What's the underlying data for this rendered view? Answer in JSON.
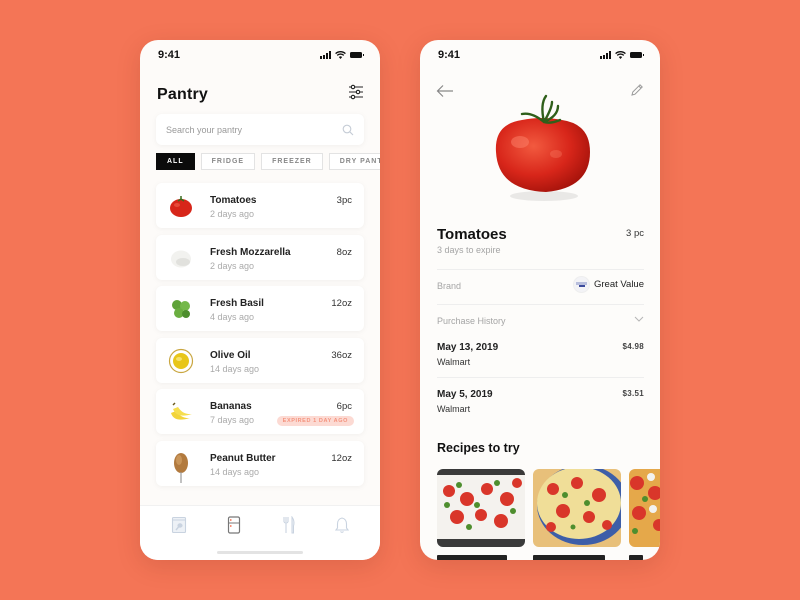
{
  "colors": {
    "background": "#F47556",
    "accent": "#F47556",
    "chip_active": "#0B0B0B",
    "badge_bg": "#FCDAD3",
    "badge_text": "#F4937E"
  },
  "left_screen": {
    "status": {
      "time": "9:41"
    },
    "title": "Pantry",
    "filter_icon": "sliders-icon",
    "search": {
      "placeholder": "Search your pantry",
      "value": "",
      "icon": "search-icon"
    },
    "filters": [
      {
        "label": "ALL",
        "active": true
      },
      {
        "label": "FRIDGE",
        "active": false
      },
      {
        "label": "FREEZER",
        "active": false
      },
      {
        "label": "DRY PANTRY",
        "active": false
      }
    ],
    "items": [
      {
        "name": "Tomatoes",
        "age": "2 days ago",
        "qty": "3pc",
        "image": "tomato"
      },
      {
        "name": "Fresh Mozzarella",
        "age": "2 days ago",
        "qty": "8oz",
        "image": "mozzarella"
      },
      {
        "name": "Fresh Basil",
        "age": "4 days ago",
        "qty": "12oz",
        "image": "basil"
      },
      {
        "name": "Olive Oil",
        "age": "14 days ago",
        "qty": "36oz",
        "image": "olive-oil"
      },
      {
        "name": "Bananas",
        "age": "7 days ago",
        "qty": "6pc",
        "image": "bananas",
        "badge": "EXPIRED 1 DAY AGO"
      },
      {
        "name": "Peanut Butter",
        "age": "14 days ago",
        "qty": "12oz",
        "image": "peanut-butter"
      }
    ],
    "tabbar": [
      {
        "name": "recipe-book-icon",
        "active": false
      },
      {
        "name": "fridge-icon",
        "active": true
      },
      {
        "name": "fork-knife-icon",
        "active": false
      },
      {
        "name": "bell-icon",
        "active": false
      }
    ]
  },
  "right_screen": {
    "status": {
      "time": "9:41"
    },
    "back_icon": "arrow-left-icon",
    "edit_icon": "pencil-icon",
    "product": {
      "name": "Tomatoes",
      "expiry": "3 days to expire",
      "qty": "3 pc"
    },
    "brand": {
      "label": "Brand",
      "value": "Great Value"
    },
    "purchase_history": {
      "label": "Purchase History",
      "entries": [
        {
          "date": "May 13, 2019",
          "store": "Walmart",
          "price": "$4.98"
        },
        {
          "date": "May 5, 2019",
          "store": "Walmart",
          "price": "$3.51"
        }
      ]
    },
    "recipes": {
      "title": "Recipes to try",
      "items": [
        {
          "image": "caprese-salad"
        },
        {
          "image": "basil-tomato-tart"
        },
        {
          "image": "tomato-salad"
        }
      ]
    }
  }
}
